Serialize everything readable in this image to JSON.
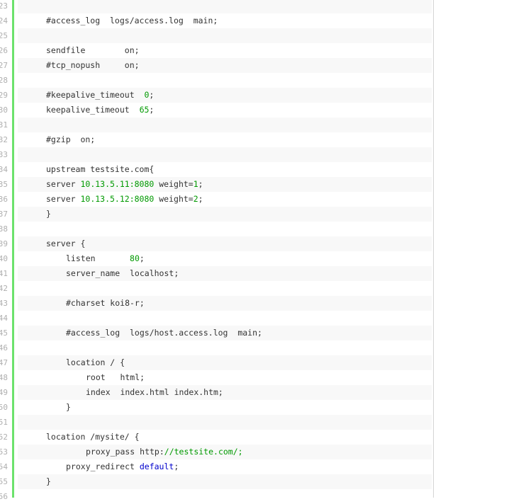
{
  "code_view": {
    "lines": [
      {
        "n": "23",
        "alt": true,
        "indent": 0,
        "parts": []
      },
      {
        "n": "24",
        "alt": false,
        "indent": 0,
        "parts": [
          {
            "t": "#access_log  logs/access.log  main;"
          }
        ]
      },
      {
        "n": "25",
        "alt": true,
        "indent": 0,
        "parts": []
      },
      {
        "n": "26",
        "alt": false,
        "indent": 0,
        "parts": [
          {
            "t": "sendfile        on;"
          }
        ]
      },
      {
        "n": "27",
        "alt": true,
        "indent": 0,
        "parts": [
          {
            "t": "#tcp_nopush     on;"
          }
        ]
      },
      {
        "n": "28",
        "alt": false,
        "indent": 0,
        "parts": []
      },
      {
        "n": "29",
        "alt": true,
        "indent": 0,
        "parts": [
          {
            "t": "#keepalive_timeout  "
          },
          {
            "t": "0",
            "c": "num"
          },
          {
            "t": ";"
          }
        ]
      },
      {
        "n": "30",
        "alt": false,
        "indent": 0,
        "parts": [
          {
            "t": "keepalive_timeout  "
          },
          {
            "t": "65",
            "c": "num"
          },
          {
            "t": ";"
          }
        ]
      },
      {
        "n": "31",
        "alt": true,
        "indent": 0,
        "parts": []
      },
      {
        "n": "32",
        "alt": false,
        "indent": 0,
        "parts": [
          {
            "t": "#gzip  on;"
          }
        ]
      },
      {
        "n": "33",
        "alt": true,
        "indent": 0,
        "parts": []
      },
      {
        "n": "34",
        "alt": false,
        "indent": 0,
        "parts": [
          {
            "t": "upstream testsite.com{"
          }
        ]
      },
      {
        "n": "35",
        "alt": true,
        "indent": 0,
        "parts": [
          {
            "t": "server "
          },
          {
            "t": "10.13.5.11:8080",
            "c": "num"
          },
          {
            "t": " weight="
          },
          {
            "t": "1",
            "c": "num"
          },
          {
            "t": ";"
          }
        ]
      },
      {
        "n": "36",
        "alt": false,
        "indent": 0,
        "parts": [
          {
            "t": "server "
          },
          {
            "t": "10.13.5.12:8080",
            "c": "num"
          },
          {
            "t": " weight="
          },
          {
            "t": "2",
            "c": "num"
          },
          {
            "t": ";"
          }
        ]
      },
      {
        "n": "37",
        "alt": true,
        "indent": 0,
        "parts": [
          {
            "t": "}"
          }
        ]
      },
      {
        "n": "38",
        "alt": false,
        "indent": 0,
        "parts": []
      },
      {
        "n": "39",
        "alt": true,
        "indent": 0,
        "parts": [
          {
            "t": "server {"
          }
        ]
      },
      {
        "n": "40",
        "alt": false,
        "indent": 4,
        "parts": [
          {
            "t": "listen       "
          },
          {
            "t": "80",
            "c": "num"
          },
          {
            "t": ";"
          }
        ]
      },
      {
        "n": "41",
        "alt": true,
        "indent": 4,
        "parts": [
          {
            "t": "server_name  localhost;"
          }
        ]
      },
      {
        "n": "42",
        "alt": false,
        "indent": 0,
        "parts": []
      },
      {
        "n": "43",
        "alt": true,
        "indent": 4,
        "parts": [
          {
            "t": "#charset koi8-r;"
          }
        ]
      },
      {
        "n": "44",
        "alt": false,
        "indent": 0,
        "parts": []
      },
      {
        "n": "45",
        "alt": true,
        "indent": 4,
        "parts": [
          {
            "t": "#access_log  logs/host.access.log  main;"
          }
        ]
      },
      {
        "n": "46",
        "alt": false,
        "indent": 0,
        "parts": []
      },
      {
        "n": "47",
        "alt": true,
        "indent": 4,
        "parts": [
          {
            "t": "location / {"
          }
        ]
      },
      {
        "n": "48",
        "alt": false,
        "indent": 8,
        "parts": [
          {
            "t": "root   html;"
          }
        ]
      },
      {
        "n": "49",
        "alt": true,
        "indent": 8,
        "parts": [
          {
            "t": "index  index.html index.htm;"
          }
        ]
      },
      {
        "n": "50",
        "alt": false,
        "indent": 4,
        "parts": [
          {
            "t": "}"
          }
        ]
      },
      {
        "n": "51",
        "alt": true,
        "indent": 0,
        "parts": []
      },
      {
        "n": "52",
        "alt": false,
        "indent": 0,
        "parts": [
          {
            "t": "location /mysite/ {"
          }
        ]
      },
      {
        "n": "53",
        "alt": true,
        "indent": 8,
        "parts": [
          {
            "t": "proxy_pass http:"
          },
          {
            "t": "//testsite.com/;",
            "c": "num"
          }
        ]
      },
      {
        "n": "54",
        "alt": false,
        "indent": 4,
        "parts": [
          {
            "t": "proxy_redirect "
          },
          {
            "t": "default",
            "c": "kw"
          },
          {
            "t": ";"
          }
        ]
      },
      {
        "n": "55",
        "alt": true,
        "indent": 0,
        "parts": [
          {
            "t": "}"
          }
        ]
      },
      {
        "n": "56",
        "alt": false,
        "indent": 0,
        "parts": []
      }
    ]
  }
}
